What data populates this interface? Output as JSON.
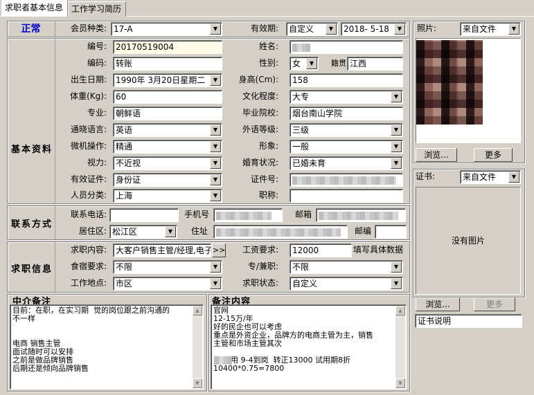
{
  "tabs": [
    "求职者基本信息",
    "工作学习简历"
  ],
  "status": "正常",
  "colors": {
    "status": "#0000cc",
    "highlight": "#fffbe6"
  },
  "member_type": {
    "label": "会员种类:",
    "value": "17-A"
  },
  "validity": {
    "label": "有效期:",
    "mode": "自定义",
    "date": "2018- 5-18"
  },
  "sections": {
    "basic": "基本资料",
    "contact": "联系方式",
    "job": "求职信息",
    "agent_notes": "中介备注",
    "notes": "备注内容"
  },
  "basic": {
    "number": {
      "label": "编号:",
      "value": "20170519004"
    },
    "code": {
      "label": "编码:",
      "value": "转账"
    },
    "birth": {
      "label": "出生日期:",
      "value": "1990年 3月20日星期二"
    },
    "weight": {
      "label": "体重(Kg):",
      "value": "60"
    },
    "major": {
      "label": "专业:",
      "value": "朝鲜语"
    },
    "language": {
      "label": "通晓语言:",
      "value": "英语"
    },
    "computer": {
      "label": "微机操作:",
      "value": "精通"
    },
    "vision": {
      "label": "视力:",
      "value": "不近视"
    },
    "id_type": {
      "label": "有效证件:",
      "value": "身份证"
    },
    "category": {
      "label": "人员分类:",
      "value": "上海"
    },
    "name": {
      "label": "姓名:"
    },
    "gender": {
      "label": "性别:",
      "value": "女"
    },
    "origin": {
      "label": "籍贯",
      "value": "江西"
    },
    "height": {
      "label": "身高(Cm):",
      "value": "158"
    },
    "education": {
      "label": "文化程度:",
      "value": "大专"
    },
    "school": {
      "label": "毕业院校:",
      "value": "烟台南山学院"
    },
    "lang_level": {
      "label": "外语等级:",
      "value": "三级"
    },
    "appearance": {
      "label": "形象:",
      "value": "一般"
    },
    "marital": {
      "label": "婚育状况:",
      "value": "已婚未育"
    },
    "id_no": {
      "label": "证件号:"
    },
    "title": {
      "label": "职称:"
    }
  },
  "contact": {
    "phone": {
      "label": "联系电话:"
    },
    "mobile": {
      "label": "手机号"
    },
    "email": {
      "label": "邮箱"
    },
    "district": {
      "label": "居住区:",
      "value": "松江区"
    },
    "address": {
      "label": "住址"
    },
    "zip": {
      "label": "邮编"
    }
  },
  "job": {
    "content": {
      "label": "求职内容:",
      "value": "大客户销售主管/经理,电子商务"
    },
    "more": ">>",
    "salary": {
      "label": "工资要求:",
      "value": "12000",
      "hint": "填写具体数据"
    },
    "housing": {
      "label": "食宿要求:",
      "value": "不限"
    },
    "type": {
      "label": "专/兼职:",
      "value": "不限"
    },
    "location": {
      "label": "工作地点:",
      "value": "市区"
    },
    "state": {
      "label": "求职状态:",
      "value": "自定义"
    }
  },
  "agent_notes_text": "目前：在职，在实习期  觉的岗位跟之前沟通的\n不一样\n\n\n电商 销售主管\n面试随时可以安排\n之前是做品牌销售\n后期还是倾向品牌销售",
  "notes_text": "官网\n12-15万/年\n好的民企也可以考虑\n重点是外资企业，品牌方的电商主管为主，销售\n主管和市场主管其次\n\n    录用 9-4到岗  转正13000 试用期8折\n10400*0.75=7800",
  "photo": {
    "label": "照片:",
    "source": "来自文件",
    "browse": "浏览...",
    "more": "更多"
  },
  "cert": {
    "label": "证书:",
    "source": "来自文件",
    "empty": "没有图片",
    "browse": "浏览...",
    "more": "更多",
    "desc": "证书说明"
  }
}
